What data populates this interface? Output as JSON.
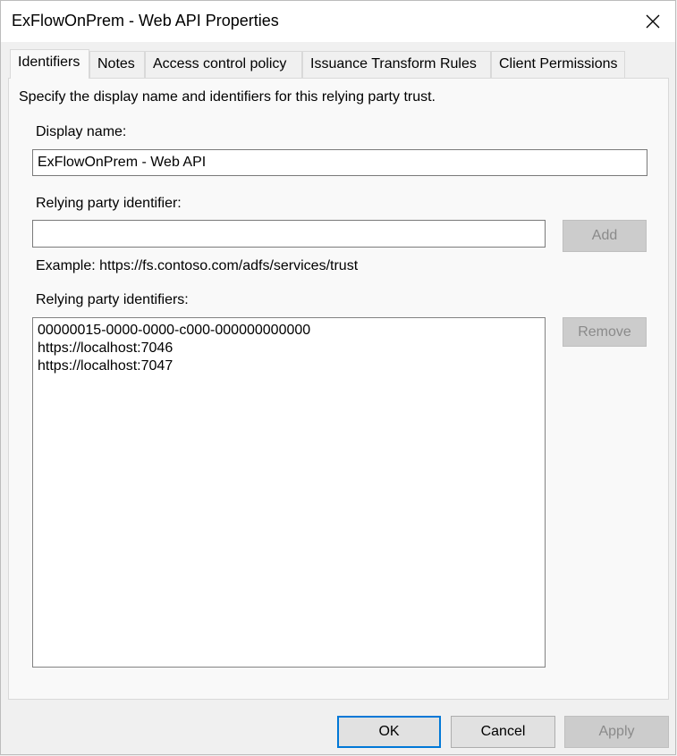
{
  "window": {
    "title": "ExFlowOnPrem - Web API Properties"
  },
  "tabs": [
    {
      "label": "Identifiers",
      "active": true
    },
    {
      "label": "Notes"
    },
    {
      "label": "Access control policy"
    },
    {
      "label": "Issuance Transform Rules"
    },
    {
      "label": "Client Permissions"
    }
  ],
  "identifiers": {
    "description": "Specify the display name and identifiers for this relying party trust.",
    "display_name_label": "Display name:",
    "display_name_value": "ExFlowOnPrem - Web API",
    "rp_identifier_label": "Relying party identifier:",
    "rp_identifier_value": "",
    "add_label": "Add",
    "example": "Example: https://fs.contoso.com/adfs/services/trust",
    "rp_identifiers_label": "Relying party identifiers:",
    "rp_identifiers": [
      "00000015-0000-0000-c000-000000000000",
      "https://localhost:7046",
      "https://localhost:7047"
    ],
    "remove_label": "Remove"
  },
  "footer": {
    "ok_label": "OK",
    "cancel_label": "Cancel",
    "apply_label": "Apply"
  }
}
